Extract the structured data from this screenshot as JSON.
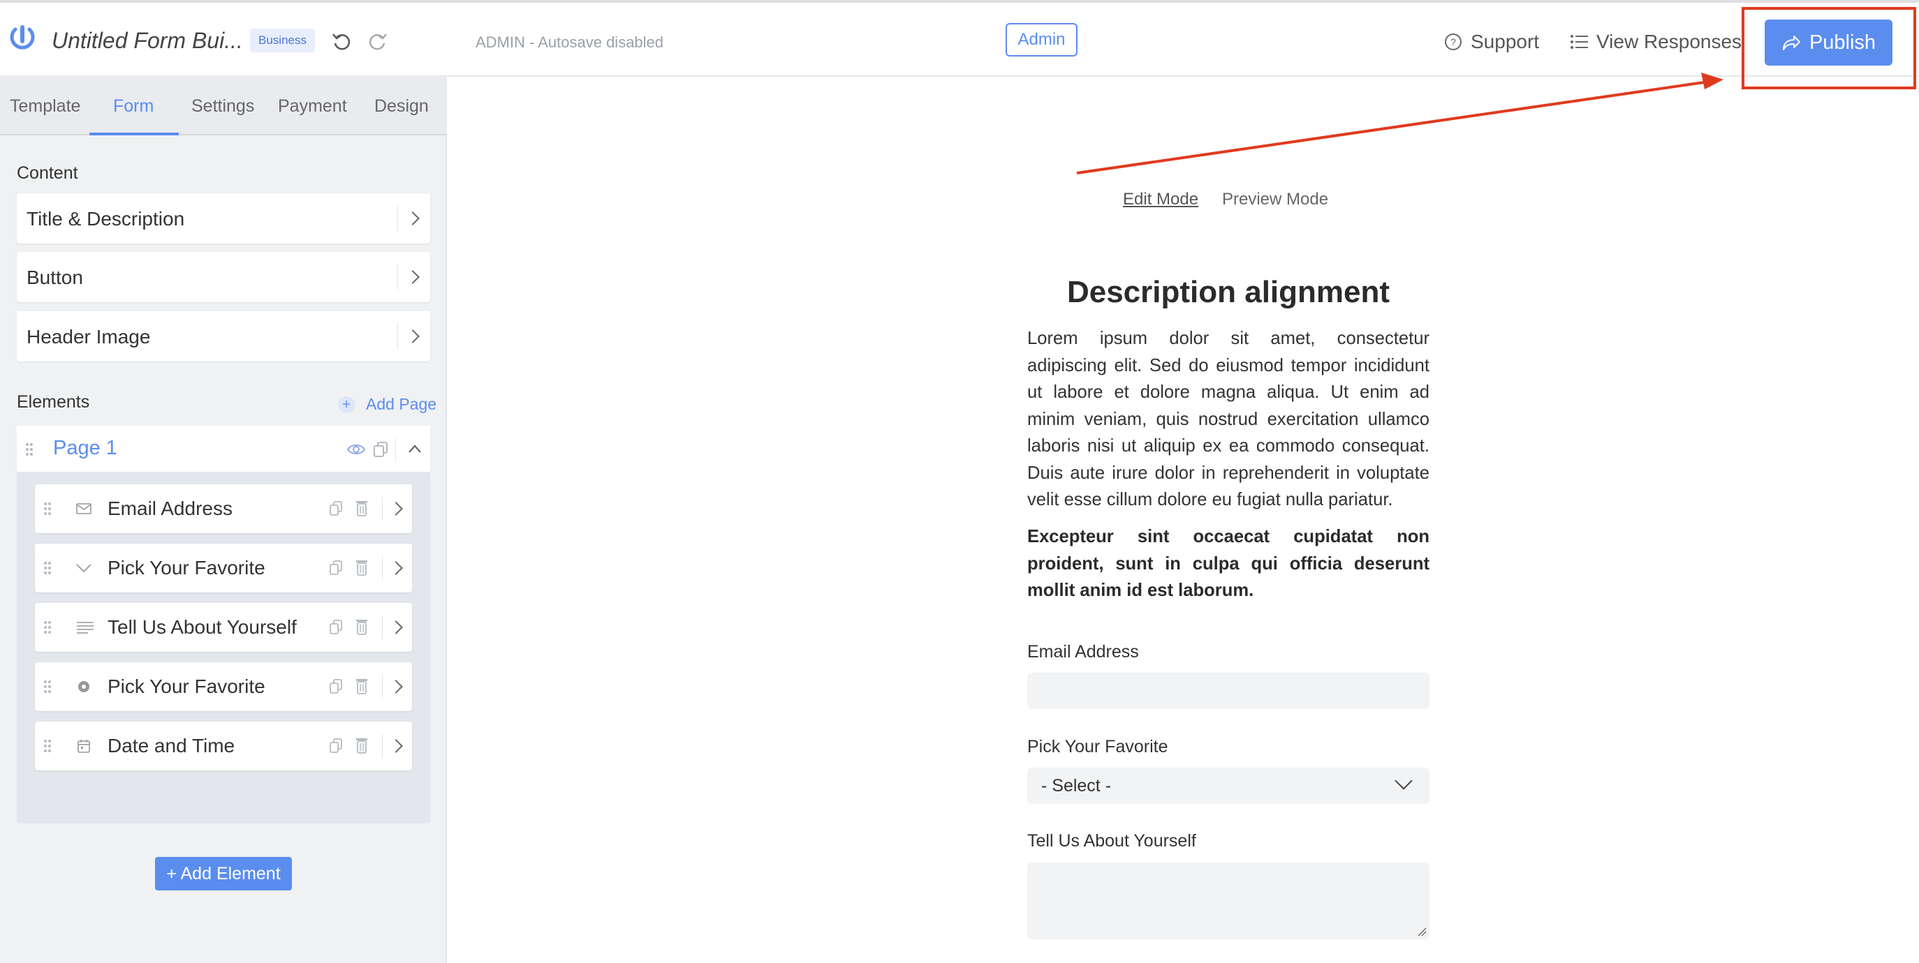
{
  "header": {
    "form_title": "Untitled Form Bui...",
    "plan_badge": "Business",
    "autosave_status": "ADMIN - Autosave disabled",
    "admin_label": "Admin",
    "support_label": "Support",
    "view_responses_label": "View Responses",
    "publish_label": "Publish"
  },
  "sidebar": {
    "tabs": [
      {
        "label": "Template",
        "active": false
      },
      {
        "label": "Form",
        "active": true
      },
      {
        "label": "Settings",
        "active": false
      },
      {
        "label": "Payment",
        "active": false
      },
      {
        "label": "Design",
        "active": false
      }
    ],
    "content_heading": "Content",
    "content_items": [
      {
        "label": "Title & Description"
      },
      {
        "label": "Button"
      },
      {
        "label": "Header Image"
      }
    ],
    "elements_heading": "Elements",
    "add_page_label": "Add Page",
    "page": {
      "title": "Page 1",
      "elements": [
        {
          "label": "Email Address",
          "icon": "envelope-icon"
        },
        {
          "label": "Pick Your Favorite",
          "icon": "chevron-down-icon"
        },
        {
          "label": "Tell Us About Yourself",
          "icon": "paragraph-icon"
        },
        {
          "label": "Pick Your Favorite",
          "icon": "radio-icon"
        },
        {
          "label": "Date and Time",
          "icon": "calendar-icon"
        }
      ]
    },
    "add_element_label": "+ Add Element"
  },
  "main": {
    "modes": {
      "edit": "Edit Mode",
      "preview": "Preview Mode",
      "active": "edit"
    },
    "title": "Description alignment",
    "description": "Lorem ipsum dolor sit amet, consectetur adipiscing elit. Sed do eiusmod tempor incididunt ut labore et dolore magna aliqua. Ut enim ad minim veniam, quis nostrud exercitation ullamco laboris nisi ut aliquip ex ea commodo consequat. Duis aute irure dolor in reprehenderit in voluptate velit esse cillum dolore eu fugiat nulla pariatur.",
    "description_bold": "Excepteur sint occaecat cupidatat non proident, sunt in culpa qui officia deserunt mollit anim id est laborum.",
    "fields": [
      {
        "label": "Email Address",
        "type": "email",
        "value": ""
      },
      {
        "label": "Pick Your Favorite",
        "type": "select",
        "value": "- Select -"
      },
      {
        "label": "Tell Us About Yourself",
        "type": "textarea",
        "value": ""
      }
    ]
  },
  "colors": {
    "accent": "#5b8def",
    "highlight_annotation": "#e03a1e",
    "sidebar_bg": "#eff1f3"
  }
}
